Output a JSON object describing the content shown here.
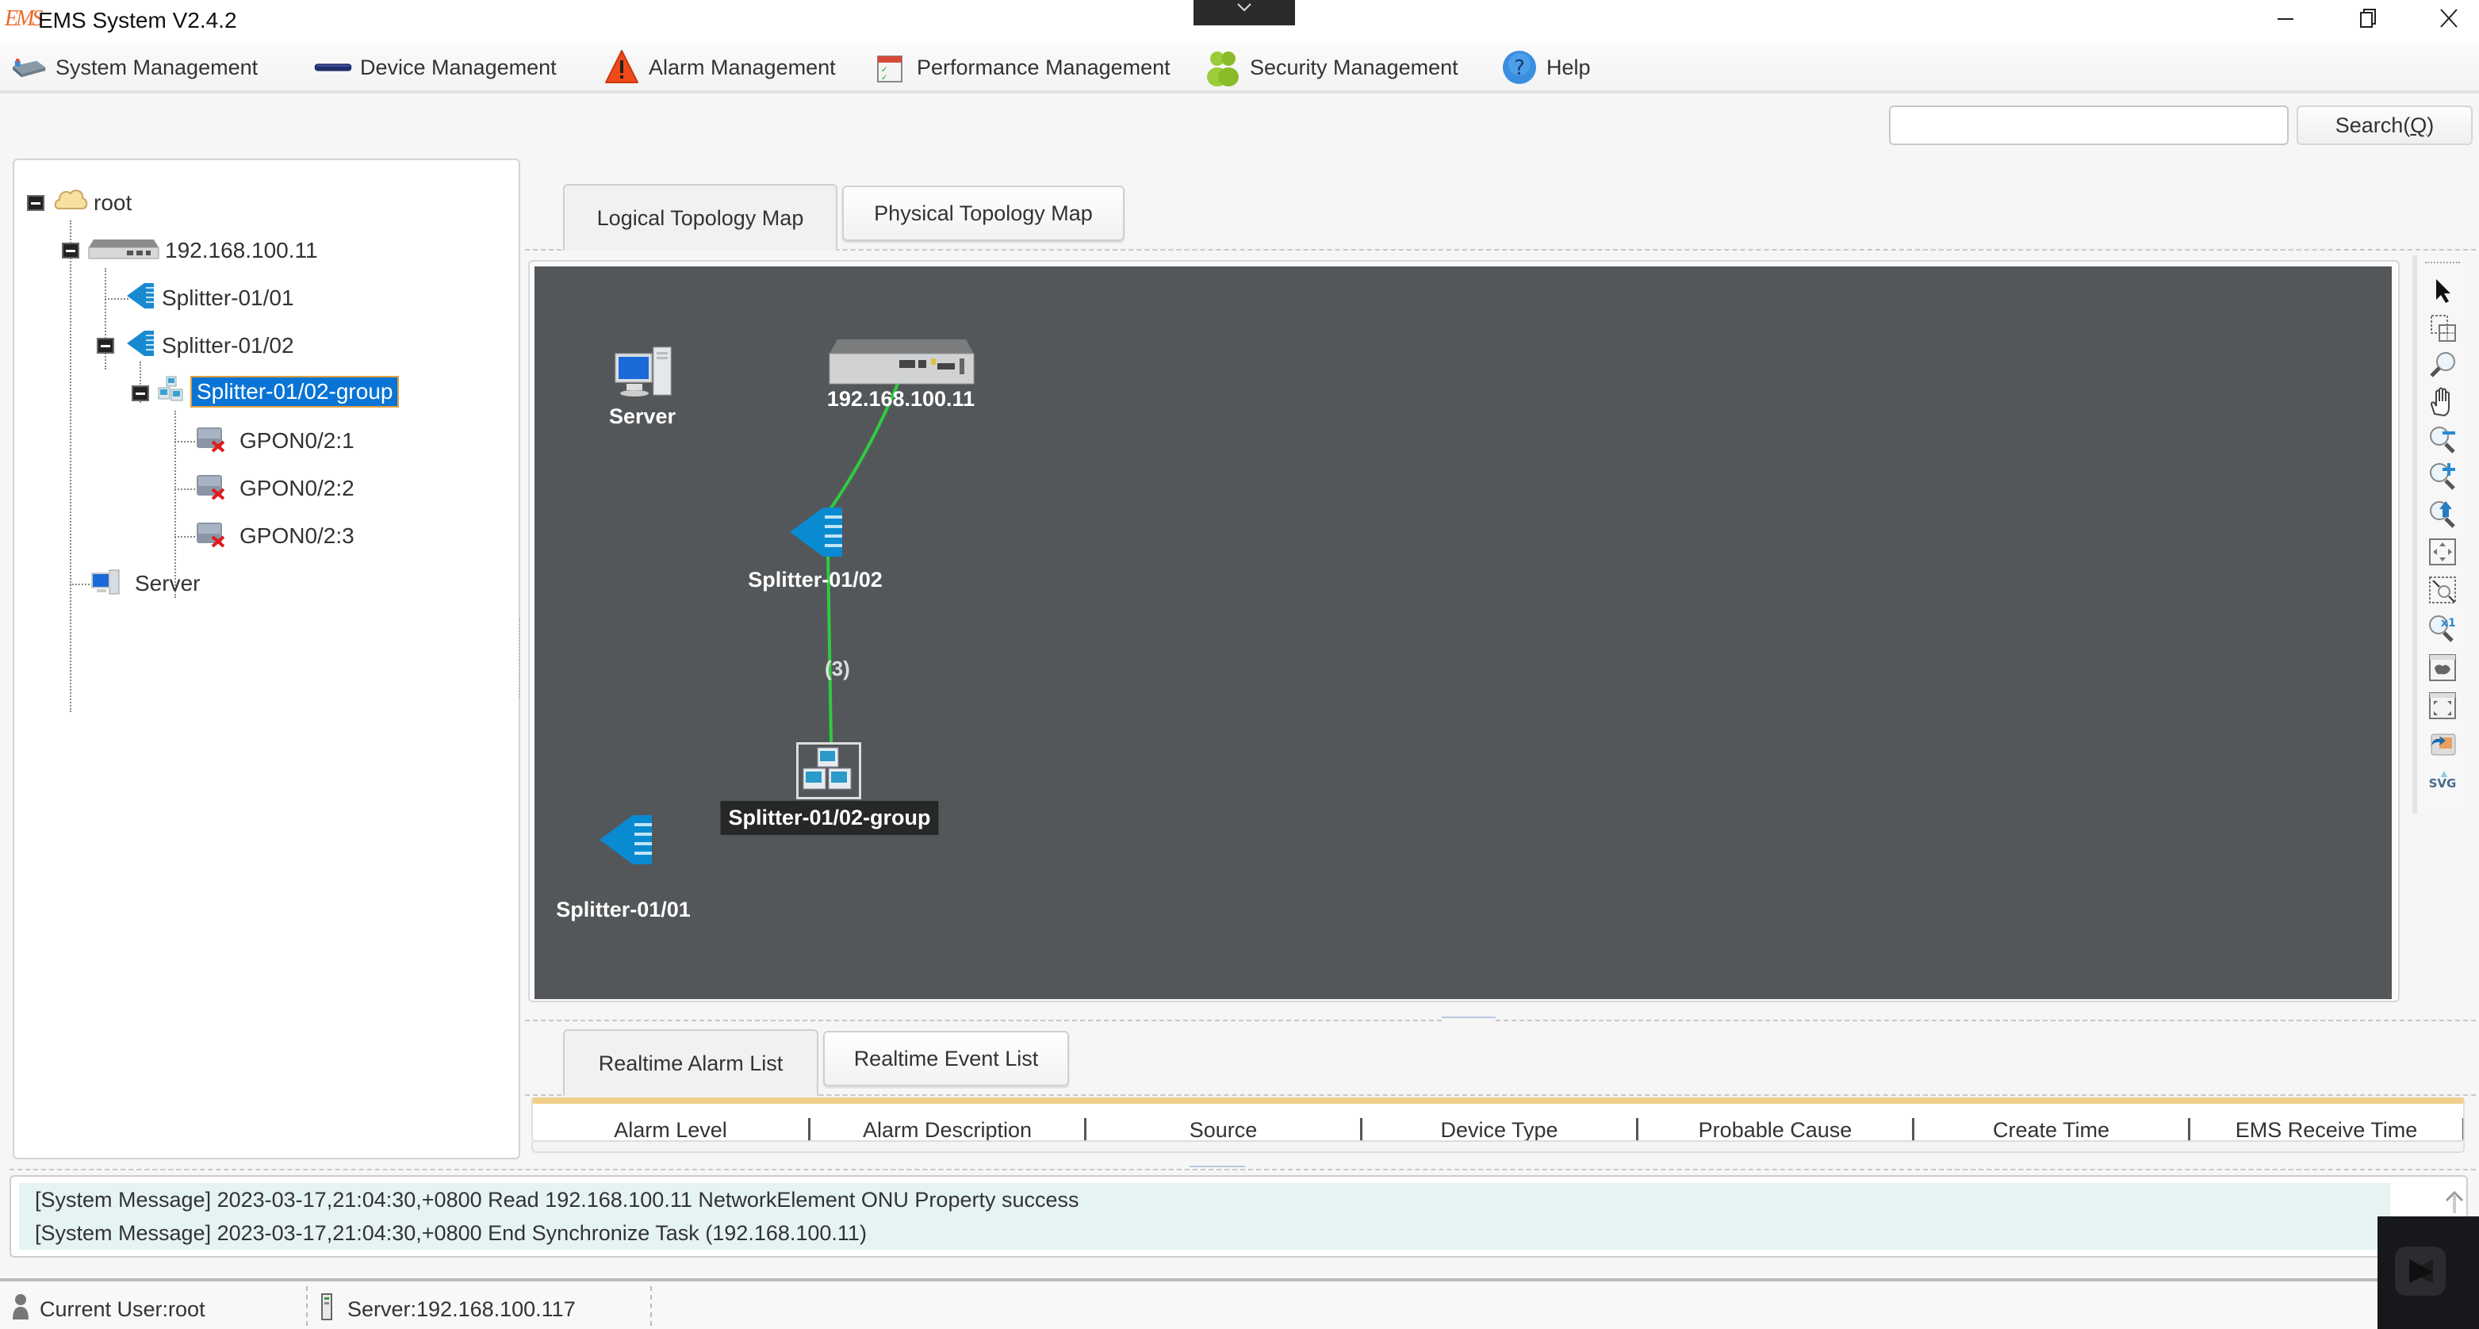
{
  "window": {
    "logo_text": "EMS",
    "title": "EMS System V2.4.2",
    "dropdown_glyph": "⌄",
    "controls": {
      "minimize": "–",
      "restore": "❐",
      "close": "✕"
    }
  },
  "menu": {
    "items": [
      {
        "label": "System Management",
        "icon": "system-management-icon"
      },
      {
        "label": "Device Management",
        "icon": "device-management-icon"
      },
      {
        "label": "Alarm Management",
        "icon": "alarm-warning-icon"
      },
      {
        "label": "Performance Management",
        "icon": "calendar-checklist-icon"
      },
      {
        "label": "Security Management",
        "icon": "users-icon"
      },
      {
        "label": "Help",
        "icon": "help-question-icon"
      }
    ]
  },
  "search": {
    "value": "",
    "placeholder": "",
    "button_label": "Search(",
    "button_mnemonic": "Q",
    "button_suffix": ")"
  },
  "tree": {
    "nodes": [
      {
        "label": "root",
        "icon": "cloud-icon",
        "expanded": true
      },
      {
        "label": "192.168.100.11",
        "icon": "olt-device-icon",
        "expanded": true
      },
      {
        "label": "Splitter-01/01",
        "icon": "splitter-icon"
      },
      {
        "label": "Splitter-01/02",
        "icon": "splitter-icon",
        "expanded": true
      },
      {
        "label": "Splitter-01/02-group",
        "icon": "group-icon",
        "expanded": true,
        "selected": true
      },
      {
        "label": "GPON0/2:1",
        "icon": "onu-offline-icon"
      },
      {
        "label": "GPON0/2:2",
        "icon": "onu-offline-icon"
      },
      {
        "label": "GPON0/2:3",
        "icon": "onu-offline-icon"
      },
      {
        "label": "Server",
        "icon": "server-icon"
      }
    ]
  },
  "topology": {
    "tabs": [
      {
        "label": "Logical Topology Map",
        "active": true
      },
      {
        "label": "Physical Topology Map",
        "active": false
      }
    ],
    "nodes": {
      "server": "Server",
      "olt": "192.168.100.11",
      "splitter_02": "Splitter-01/02",
      "group": "Splitter-01/02-group",
      "splitter_01": "Splitter-01/01"
    },
    "link_label": "(3)",
    "link_color": "#2ecc40",
    "canvas_color": "#545759",
    "toolbar": [
      "select-pointer-icon",
      "marquee-select-icon",
      "zoom-magnifier-icon",
      "pan-hand-icon",
      "zoom-out-icon",
      "zoom-in-icon",
      "zoom-reset-icon",
      "fit-to-screen-icon",
      "zoom-region-icon",
      "zoom-1x-icon",
      "overview-map-icon",
      "fullscreen-icon",
      "export-image-icon",
      "export-svg-icon"
    ]
  },
  "alarms": {
    "tabs": [
      {
        "label": "Realtime Alarm List",
        "active": true
      },
      {
        "label": "Realtime Event List",
        "active": false
      }
    ],
    "columns": [
      "Alarm Level",
      "Alarm Description",
      "Source",
      "Device Type",
      "Probable Cause",
      "Create Time",
      "EMS Receive Time"
    ],
    "rows": []
  },
  "messages": [
    "[System Message]  2023-03-17,21:04:30,+0800 Read 192.168.100.11 NetworkElement ONU Property success",
    "[System Message]  2023-03-17,21:04:30,+0800 End Synchronize Task (192.168.100.11)"
  ],
  "status": {
    "current_user": "Current User:root",
    "server": "Server:192.168.100.117"
  },
  "colors": {
    "selection": "#0a74d6",
    "accent_bar": "#f0cf8c",
    "message_bg": "#e5f3f3"
  }
}
